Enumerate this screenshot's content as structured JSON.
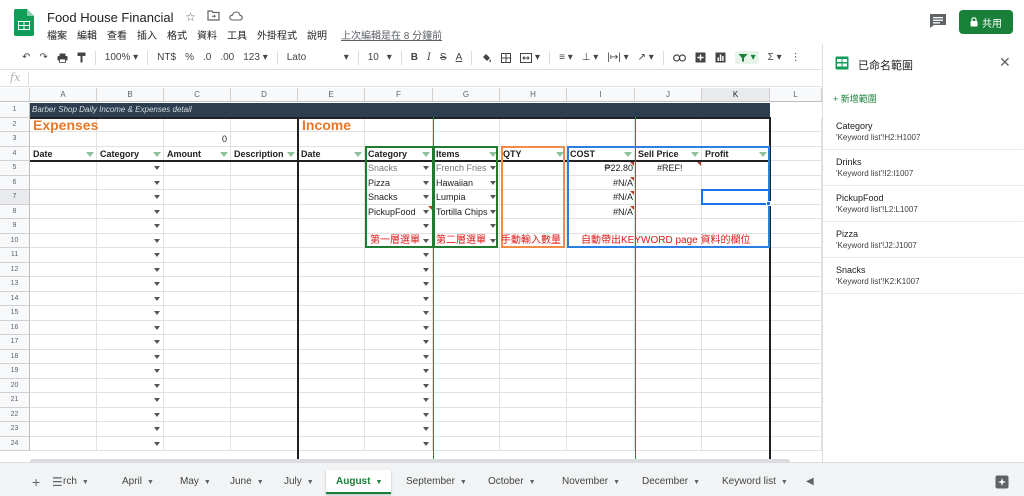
{
  "app": {
    "title": "Food House Financial",
    "menu": [
      "檔案",
      "編輯",
      "查看",
      "插入",
      "格式",
      "資料",
      "工具",
      "外掛程式",
      "說明"
    ],
    "last_edit": "上次編輯是在 8 分鐘前",
    "share_label": "共用",
    "brand_color": "#188038"
  },
  "toolbar": {
    "zoom": "100%",
    "currency": "NT$",
    "percent": "%",
    "dec_less": ".0",
    "dec_more": ".00",
    "format_more": "123",
    "font": "Lato",
    "font_size": "10"
  },
  "formula_bar": {
    "fx": "fx"
  },
  "sheet": {
    "columns": [
      "A",
      "B",
      "C",
      "D",
      "E",
      "F",
      "G",
      "H",
      "I",
      "J",
      "K",
      "L"
    ],
    "rows": [
      "1",
      "2",
      "3",
      "4",
      "5",
      "6",
      "7",
      "8",
      "9",
      "10",
      "11",
      "12",
      "13",
      "14",
      "15",
      "16",
      "17",
      "18",
      "19",
      "20",
      "21",
      "22",
      "23",
      "24"
    ],
    "banner": "Barber Shop Daily Income & Expenses detail",
    "expenses_title": "Expenses",
    "income_title": "Income",
    "c3_value": "0",
    "expense_headers": [
      "Date",
      "Category",
      "Amount",
      "Description"
    ],
    "income_headers": [
      "Date",
      "Category",
      "Items",
      "QTY",
      "COST",
      "Sell Price",
      "Profit"
    ],
    "income_rows": [
      {
        "category": "Snacks",
        "item": "French Fries",
        "cost": "₱22.80",
        "sell": "#REF!"
      },
      {
        "category": "Pizza",
        "item": "Hawaiian",
        "cost": "#N/A",
        "sell": ""
      },
      {
        "category": "Snacks",
        "item": "Lumpia",
        "cost": "#N/A",
        "sell": ""
      },
      {
        "category": "PickupFood",
        "item": "Tortilla Chips",
        "cost": "#N/A",
        "sell": ""
      }
    ],
    "annotations": {
      "first_menu": "第一層選單",
      "second_menu": "第二層選單",
      "manual_qty": "手動輸入數量",
      "auto_fill": "自動帶出KEYWORD page 資料的欄位"
    }
  },
  "named_ranges": {
    "title": "已命名範圍",
    "add_label": "+ 新增範圍",
    "items": [
      {
        "name": "Category",
        "ref": "'Keyword list'!H2:H1007"
      },
      {
        "name": "Drinks",
        "ref": "'Keyword list'!I2:I1007"
      },
      {
        "name": "PickupFood",
        "ref": "'Keyword list'!L2:L1007"
      },
      {
        "name": "Pizza",
        "ref": "'Keyword list'!J2:J1007"
      },
      {
        "name": "Snacks",
        "ref": "'Keyword list'!K2:K1007"
      }
    ]
  },
  "tabs": {
    "items": [
      "rch",
      "April",
      "May",
      "June",
      "July",
      "August",
      "September",
      "October",
      "November",
      "December",
      "Keyword list"
    ],
    "active": "August"
  }
}
